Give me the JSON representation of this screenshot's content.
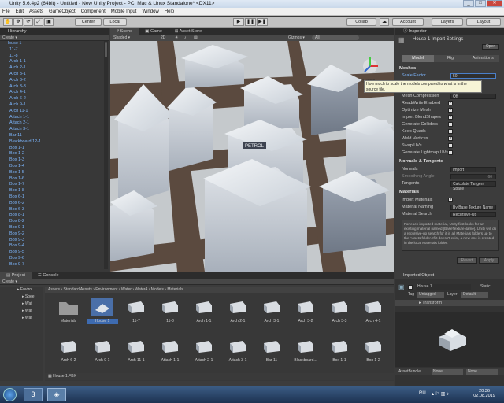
{
  "window": {
    "title": "Unity 5.6.4p2 (64bit) - Untitled - New Unity Project - PC, Mac & Linux Standalone* <DX11>"
  },
  "menu": [
    "File",
    "Edit",
    "Assets",
    "GameObject",
    "Component",
    "Mobile Input",
    "Window",
    "Help"
  ],
  "toolbar": {
    "center": "Center",
    "local": "Local",
    "collab": "Collab",
    "account": "Account",
    "layers": "Layers",
    "layout": "Layout"
  },
  "hierarchy": {
    "title": "Hierarchy",
    "create": "Create",
    "items": [
      "House 1",
      "11-7",
      "11-8",
      "Arch 1-1",
      "Arch 2-1",
      "Arch 3-1",
      "Arch 3-2",
      "Arch 3-3",
      "Arch 4-1",
      "Arch 6-2",
      "Arch 9-1",
      "Arch 11-1",
      "Attach 1-1",
      "Attach 2-1",
      "Attach 3-1",
      "Bar 11",
      "Blackboard 12-1",
      "Box 1-1",
      "Box 1-2",
      "Box 1-3",
      "Box 1-4",
      "Box 1-5",
      "Box 1-6",
      "Box 1-7",
      "Box 1-8",
      "Box 6-1",
      "Box 6-2",
      "Box 6-3",
      "Box 8-1",
      "Box 8-2",
      "Box 9-1",
      "Box 9-2",
      "Box 9-3",
      "Box 9-4",
      "Box 9-5",
      "Box 9-6",
      "Box 9-7"
    ]
  },
  "scene": {
    "tabs": [
      "Scene",
      "Game",
      "Asset Store"
    ],
    "shaded": "Shaded",
    "mode2d": "2D",
    "gizmos": "Gizmos",
    "search": "All"
  },
  "inspector": {
    "title": "Inspector",
    "object": "House 1 Import Settings",
    "open": "Open",
    "tabs": [
      "Model",
      "Rig",
      "Animations"
    ],
    "meshes": "Meshes",
    "scale_factor_label": "Scale Factor",
    "scale_factor_value": "50",
    "tooltip": "How much to scale the models compared to what is in the source file.",
    "rows": [
      "Mesh Compression",
      "Read/Write Enabled",
      "Optimize Mesh",
      "Import BlendShapes",
      "Generate Colliders",
      "Keep Quads",
      "Weld Vertices",
      "Swap UVs",
      "Generate Lightmap UVs"
    ],
    "mesh_compression_value": "Off",
    "normals_section": "Normals & Tangents",
    "normals_label": "Normals",
    "normals_value": "Import",
    "smoothing_label": "Smoothing Angle",
    "smoothing_value": "60",
    "tangents_label": "Tangents",
    "tangents_value": "Calculate Tangent Space",
    "materials_section": "Materials",
    "import_materials": "Import Materials",
    "material_naming": "Material Naming",
    "material_naming_value": "By Base Texture Name",
    "material_search": "Material Search",
    "material_search_value": "Recursive-Up",
    "help": "For each imported material, Unity first looks for an existing material named [BaseTextureName]. Unity will do a recursive-up search for it in all Materials folders up to the Assets folder. If it doesn't exist, a new one is created in the local Materials folder.",
    "revert": "Revert",
    "apply": "Apply"
  },
  "imported": {
    "title": "Imported Object",
    "name": "House 1",
    "static": "Static",
    "tag": "Tag",
    "tag_value": "Untagged",
    "layer": "Layer",
    "layer_value": "Default",
    "transform": "Transform",
    "assetbundle": "AssetBundle",
    "ab_value": "None",
    "ab_variant": "None"
  },
  "project": {
    "tabs": [
      "Project",
      "Console"
    ],
    "create": "Create",
    "breadcrumb": "Assets › Standard Assets › Environment › Water › Water4 › Models › Materials",
    "tree": [
      "Enviro",
      "Spee",
      "Wat",
      "Wat",
      "Wat"
    ],
    "assets_row1": [
      "Materials",
      "House 1",
      "11-7",
      "11-8",
      "Arch 1-1",
      "Arch 2-1",
      "Arch 3-1",
      "Arch 3-2",
      "Arch 3-3",
      "Arch 4-1"
    ],
    "assets_row2": [
      "Arch 6-2",
      "Arch 9-1",
      "Arch 11-1",
      "Attach 1-1",
      "Attach 2-1",
      "Attach 3-1",
      "Bar 11",
      "Blackboard...",
      "Box 1-1",
      "Box 1-2"
    ],
    "selected": "House 1.FBX"
  },
  "taskbar": {
    "lang": "RU",
    "time": "20:36",
    "date": "02.08.2019"
  }
}
